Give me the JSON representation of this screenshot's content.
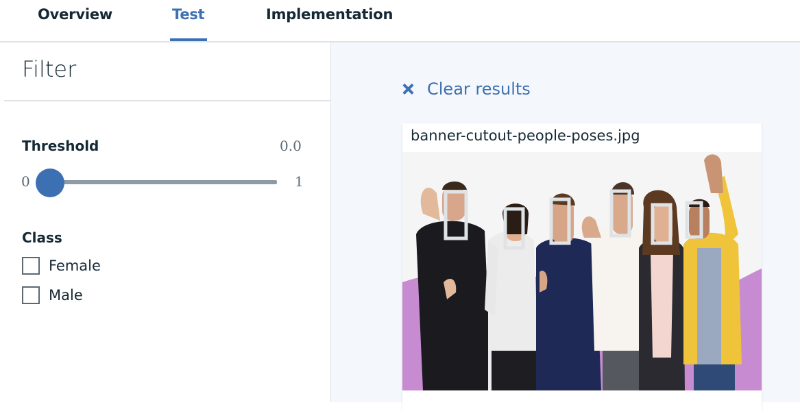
{
  "tabs": [
    {
      "label": "Overview",
      "active": false
    },
    {
      "label": "Test",
      "active": true
    },
    {
      "label": "Implementation",
      "active": false
    }
  ],
  "filter": {
    "title": "Filter",
    "threshold": {
      "label": "Threshold",
      "value": "0.0",
      "min": "0",
      "max": "1",
      "level": 0.0
    },
    "class": {
      "label": "Class",
      "options": [
        {
          "label": "Female",
          "checked": false
        },
        {
          "label": "Male",
          "checked": false
        }
      ]
    }
  },
  "results": {
    "clear_label": "Clear results",
    "image": {
      "filename": "banner-cutout-people-poses.jpg",
      "detected_faces": 6
    }
  },
  "colors": {
    "accent": "#3d70b2",
    "text": "#152935",
    "muted": "#5a6872",
    "divider": "#dfe3e6",
    "panel_bg": "#f4f7fb",
    "photo_purple": "#c68bd1",
    "box_outline": "#dfe3e6"
  },
  "icons": {
    "clear": "close-icon",
    "slider": "slider-handle"
  }
}
